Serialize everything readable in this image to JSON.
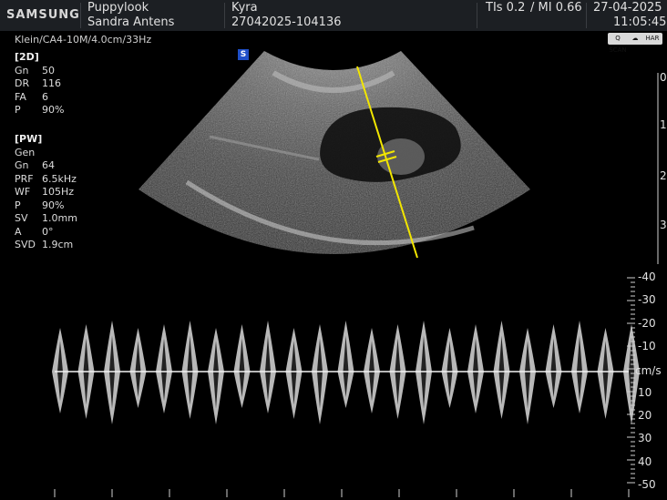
{
  "header": {
    "brand": "SAMSUNG",
    "clinic": "Puppylook",
    "operator": "Sandra Antens",
    "patient": "Kyra",
    "study_id": "27042025-104136",
    "tis": "TIs 0.2",
    "mi": "/ MI 0.66",
    "date": "27-04-2025",
    "time": "11:05:45"
  },
  "probe_info": "Klein/CA4-10M/4.0cm/33Hz",
  "mode_badge": "S",
  "mode_2d": {
    "title": "[2D]",
    "params": [
      {
        "k": "Gn",
        "v": "50"
      },
      {
        "k": "DR",
        "v": "116"
      },
      {
        "k": "FA",
        "v": "6"
      },
      {
        "k": "P",
        "v": "90%"
      }
    ]
  },
  "mode_pw": {
    "title": "[PW]",
    "sub": "Gen",
    "params": [
      {
        "k": "Gn",
        "v": "64"
      },
      {
        "k": "PRF",
        "v": "6.5kHz"
      },
      {
        "k": "WF",
        "v": "105Hz"
      },
      {
        "k": "P",
        "v": "90%"
      },
      {
        "k": "SV",
        "v": "1.0mm"
      },
      {
        "k": "A",
        "v": "0°"
      },
      {
        "k": "SVD",
        "v": "1.9cm"
      }
    ]
  },
  "icons": [
    {
      "name": "q-scan-icon",
      "label": "Q SCAN"
    },
    {
      "name": "cloud-icon",
      "label": "☁"
    },
    {
      "name": "har-icon",
      "label": "HAR"
    }
  ],
  "depth_scale": [
    "0",
    "1",
    "2",
    "3"
  ],
  "velocity_scale": {
    "unit": "cm/s",
    "ticks": [
      "-40",
      "-30",
      "-20",
      "-10",
      "10",
      "20",
      "30",
      "40",
      "-50"
    ]
  },
  "colors": {
    "header_bg": "#1c1f23",
    "cursor_line": "#f2e600",
    "badge": "#1f4fc8"
  }
}
